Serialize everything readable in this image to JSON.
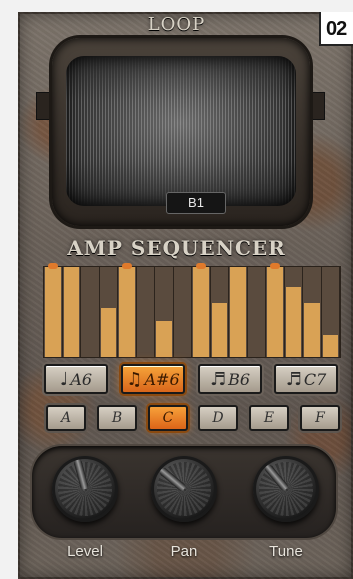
{
  "badge": "02",
  "loop": {
    "title": "LOOP",
    "selected": "B1"
  },
  "sequencer": {
    "title": "AMP SEQUENCER",
    "steps": [
      {
        "level": 1.0,
        "marked": true
      },
      {
        "level": 1.0,
        "marked": false
      },
      {
        "level": 0.0,
        "marked": false
      },
      {
        "level": 0.55,
        "marked": false
      },
      {
        "level": 1.0,
        "marked": true
      },
      {
        "level": 0.0,
        "marked": false
      },
      {
        "level": 0.4,
        "marked": false
      },
      {
        "level": 0.0,
        "marked": false
      },
      {
        "level": 1.0,
        "marked": true
      },
      {
        "level": 0.6,
        "marked": false
      },
      {
        "level": 1.0,
        "marked": false
      },
      {
        "level": 0.0,
        "marked": false
      },
      {
        "level": 1.0,
        "marked": true
      },
      {
        "level": 0.78,
        "marked": false
      },
      {
        "level": 0.6,
        "marked": false
      },
      {
        "level": 0.25,
        "marked": false
      }
    ],
    "bar_color": "#d9a255",
    "marker_color": "#e07a2b"
  },
  "notes": [
    {
      "label": "A6",
      "icon": "single-note-icon",
      "glyph": "♩",
      "active": false
    },
    {
      "label": "A#6",
      "icon": "double-note-icon",
      "glyph": "♫",
      "active": true
    },
    {
      "label": "B6",
      "icon": "sixteenth-note-icon",
      "glyph": "♬",
      "active": false
    },
    {
      "label": "C7",
      "icon": "thirty-second-note-icon",
      "glyph": "♬",
      "active": false
    }
  ],
  "letters": [
    {
      "label": "A",
      "active": false
    },
    {
      "label": "B",
      "active": false
    },
    {
      "label": "C",
      "active": true
    },
    {
      "label": "D",
      "active": false
    },
    {
      "label": "E",
      "active": false
    },
    {
      "label": "F",
      "active": false
    }
  ],
  "knobs": [
    {
      "label": "Level",
      "rotation_deg": -15
    },
    {
      "label": "Pan",
      "rotation_deg": -50
    },
    {
      "label": "Tune",
      "rotation_deg": -40
    }
  ],
  "accent_color": "#f08a2a"
}
